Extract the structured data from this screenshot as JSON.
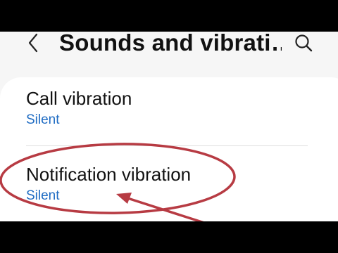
{
  "header": {
    "title": "Sounds and vibrati…",
    "back_icon": "chevron-left-icon",
    "search_icon": "search-icon"
  },
  "settings": {
    "items": [
      {
        "label": "Call vibration",
        "value": "Silent"
      },
      {
        "label": "Notification vibration",
        "value": "Silent"
      }
    ]
  },
  "colors": {
    "value_accent": "#1f6cc3",
    "annotation_red": "#b73b43",
    "background": "#f6f6f6",
    "card": "#ffffff"
  }
}
